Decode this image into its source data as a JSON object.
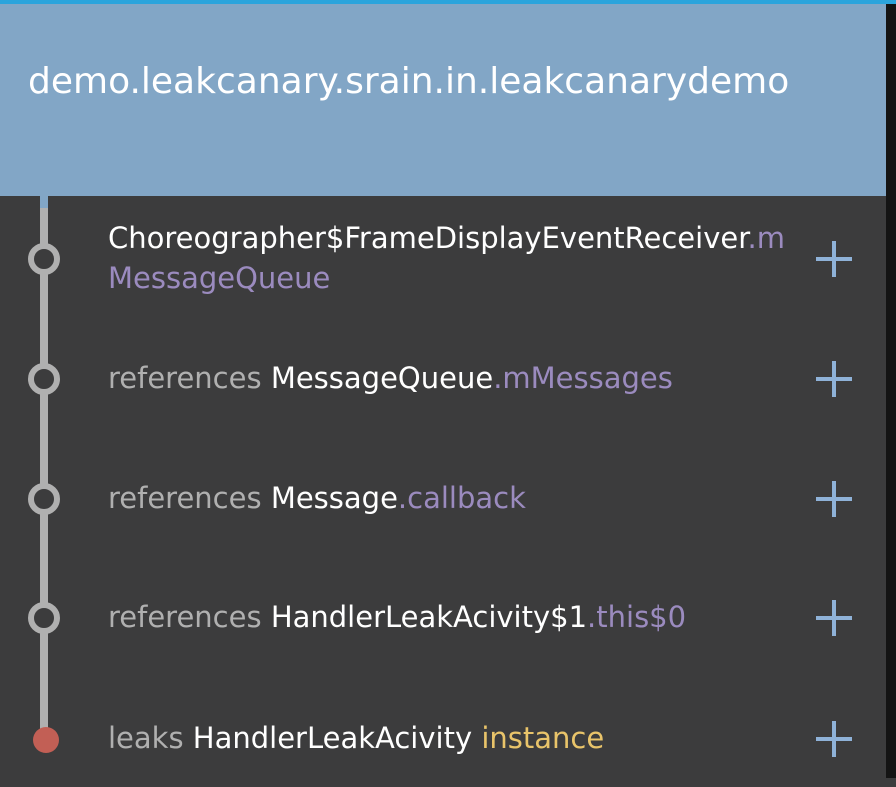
{
  "header": {
    "title": "demo.leakcanary.srain.in.leakcanarydemo"
  },
  "trace": [
    {
      "prefix": "",
      "class_name": "Choreographer$FrameDisplayEventReceiver",
      "separator": ".",
      "field": "mMessageQueue",
      "suffix": "",
      "action": "+"
    },
    {
      "prefix": "references ",
      "class_name": "MessageQueue",
      "separator": ".",
      "field": "mMessages",
      "suffix": "",
      "action": "+"
    },
    {
      "prefix": "references ",
      "class_name": "Message",
      "separator": ".",
      "field": "callback",
      "suffix": "",
      "action": "+"
    },
    {
      "prefix": "references ",
      "class_name": "HandlerLeakAcivity$1",
      "separator": ".",
      "field": "this$0",
      "suffix": "",
      "action": "+"
    },
    {
      "prefix": "leaks ",
      "class_name": "HandlerLeakAcivity",
      "separator": "",
      "field": "",
      "suffix": " instance",
      "action": "+"
    }
  ],
  "colors": {
    "header_bg": "#82a6c6",
    "body_bg": "#3c3c3d",
    "trace_line": "#b0b0b0",
    "field_text": "#9b8bbf",
    "instance_text": "#e9c46a",
    "leak_node": "#c25f55",
    "plus_icon": "#8fb2d8"
  }
}
